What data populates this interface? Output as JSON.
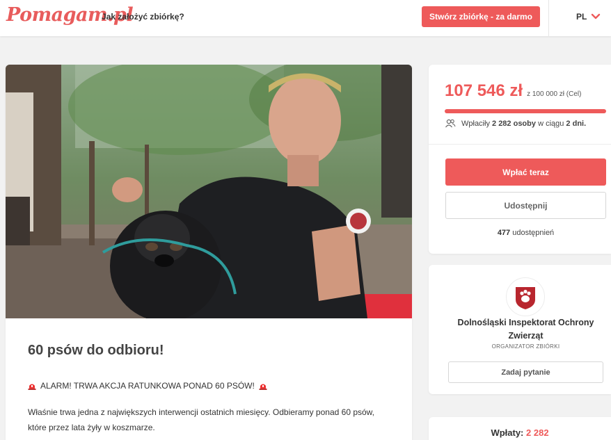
{
  "header": {
    "logo": "Pomagam.pl",
    "how_link": "Jak założyć zbiórkę?",
    "create_button": "Stwórz zbiórkę - za darmo",
    "language": "PL"
  },
  "campaign": {
    "title": "60 psów do odbioru!",
    "alarm_text": "ALARM! TRWA AKCJA RATUNKOWA PONAD 60 PSÓW!",
    "paragraph": "Właśnie trwa jedna z największych interwencji ostatnich miesięcy. Odbieramy ponad 60 psów, które przez lata żyły w koszmarze."
  },
  "funding": {
    "raised": "107 546 zł",
    "goal_text": "z 100 000 zł (Cel)",
    "progress_fraction": 1.0,
    "donors_prefix": "Wpłaciły",
    "donors_count": "2 282 osoby",
    "donors_mid": "w ciągu",
    "donors_days": "2 dni.",
    "pay_button": "Wpłać teraz",
    "share_button": "Udostępnij",
    "shares_count": "477",
    "shares_label": "udostępnień"
  },
  "organizer": {
    "name": "Dolnośląski Inspektorat Ochrony Zwierząt",
    "role": "ORGANIZATOR ZBIÓRKI",
    "ask_button": "Zadaj pytanie"
  },
  "payments": {
    "label": "Wpłaty:",
    "count": "2 282"
  },
  "colors": {
    "accent": "#ee5a5a",
    "progress_bg": "#f4b3b3"
  },
  "icons": {
    "language_chevron": "chevron-down-icon",
    "siren": "siren-icon",
    "donors": "people-icon",
    "organizer_logo": "paw-shield-icon"
  }
}
